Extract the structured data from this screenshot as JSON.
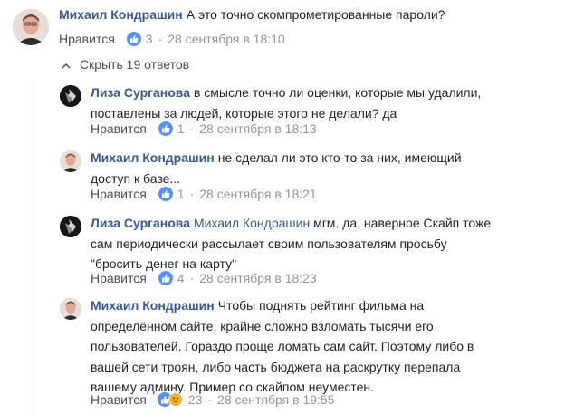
{
  "comments": [
    {
      "author": "Михаил Кондрашин",
      "text": "А это точно скомпрометированные пароли?",
      "like_label": "Нравится",
      "reactions": 3,
      "time": "28 сентября в 18:10",
      "avatar": "man-avatar"
    }
  ],
  "hide_replies_label": "Скрыть 19 ответов",
  "replies": [
    {
      "author": "Лиза Сурганова",
      "lines": [
        "в смысле точно ли оценки, которые мы удалили,",
        "поставлены за людей, которые этого не делали? да"
      ],
      "like_label": "Нравится",
      "reactions": 1,
      "time": "28 сентября в 18:13",
      "avatar": "woman-avatar"
    },
    {
      "author": "Михаил Кондрашин",
      "lines": [
        "не сделал ли это кто-то за них, имеющий",
        "доступ к базе..."
      ],
      "like_label": "Нравится",
      "reactions": 1,
      "time": "28 сентября в 18:21",
      "avatar": "man-avatar"
    },
    {
      "author": "Лиза Сурганова",
      "mention": "Михаил Кондрашин",
      "lines": [
        "мгм. да, наверное Скайп тоже",
        "сам периодически рассылает своим пользователям просьбу",
        "\"бросить денег на карту\""
      ],
      "like_label": "Нравится",
      "reactions": 4,
      "time": "28 сентября в 18:23",
      "avatar": "woman-avatar"
    },
    {
      "author": "Михаил Кондрашин",
      "lines": [
        "Чтобы поднять рейтинг фильма на",
        "определённом сайте, крайне сложно взломать тысячи его",
        "пользователей. Гораздо проще ломать сам сайт. Поэтому либо в",
        "вашей сети троян, либо часть бюджета на раскрутку перепала",
        "вашему админу. Пример со скайпом неуместен."
      ],
      "like_label": "Нравится",
      "reactions": 23,
      "time": "28 сентября в 19:55",
      "avatar": "man-avatar"
    }
  ],
  "colors": {
    "link": "#385898",
    "text": "#1d2129",
    "meta": "#90949c",
    "like_blue": "#5890ff",
    "haha_yellow": "#f7b125"
  }
}
